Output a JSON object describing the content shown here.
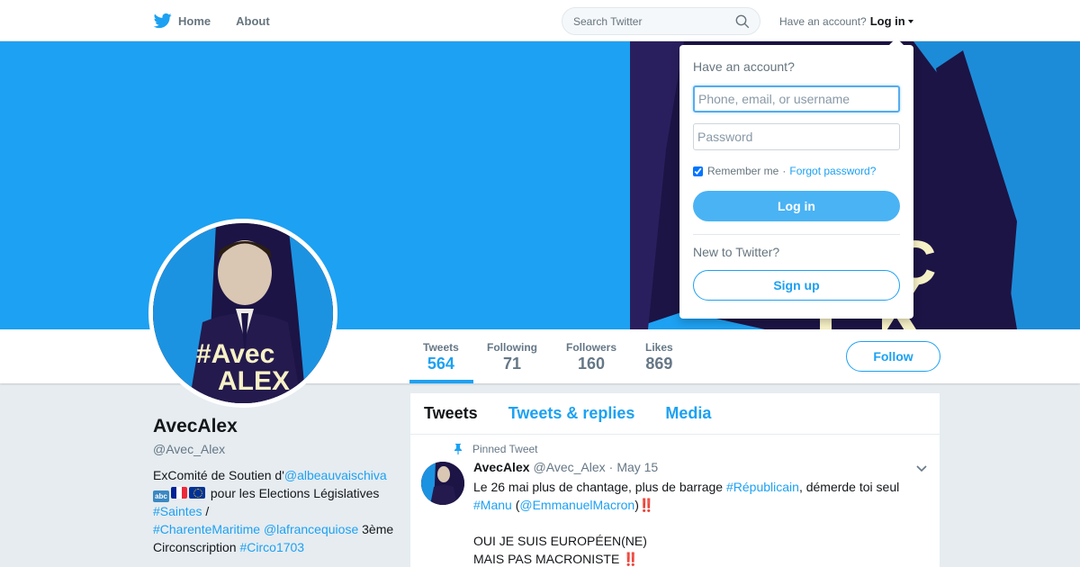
{
  "nav": {
    "home_label": "Home",
    "about_label": "About",
    "search_placeholder": "Search Twitter",
    "have_account": "Have an account?",
    "login_label": "Log in"
  },
  "profile": {
    "name": "AvecAlex",
    "handle": "@Avec_Alex",
    "avatar_text_1": "#Avec",
    "avatar_text_2": "ALEX",
    "bio": {
      "prefix": "ExComité de Soutien d'",
      "mention_1": "@albeauvaischiva",
      "emoji_abc": "abc",
      "middle": " pour les Elections Législatives ",
      "hashtag_1": "#Saintes",
      "sep": " / ",
      "hashtag_2": "#CharenteMaritime",
      "space": " ",
      "mention_2": "@lafrancequiose",
      "suffix": " 3ème Circonscription ",
      "hashtag_3": "#Circo1703"
    }
  },
  "stats": [
    {
      "label": "Tweets",
      "value": "564"
    },
    {
      "label": "Following",
      "value": "71"
    },
    {
      "label": "Followers",
      "value": "160"
    },
    {
      "label": "Likes",
      "value": "869"
    }
  ],
  "follow_label": "Follow",
  "timeline": {
    "tabs": [
      "Tweets",
      "Tweets & replies",
      "Media"
    ],
    "pinned_label": "Pinned Tweet",
    "tweet": {
      "name": "AvecAlex",
      "handle": "@Avec_Alex",
      "dot": "·",
      "date": "May 15",
      "line1_pre": "Le 26 mai plus de chantage, plus de barrage ",
      "line1_tag": "#Républicain",
      "line1_post": ", démerde toi seul",
      "line2_tag": "#Manu",
      "line2_open": " (",
      "line2_mention": "@EmmanuelMacron",
      "line2_close": ")",
      "bang": "‼️",
      "line3": "OUI JE SUIS EUROPÉEN(NE)",
      "line4": "MAIS PAS MACRONISTE "
    }
  },
  "login_dropdown": {
    "title": "Have an account?",
    "username_placeholder": "Phone, email, or username",
    "password_placeholder": "Password",
    "remember_label": "Remember me",
    "separator": "·",
    "forgot_label": "Forgot password?",
    "login_button": "Log in",
    "new_label": "New to Twitter?",
    "signup_button": "Sign up"
  },
  "banner_text": "C\nEX",
  "colors": {
    "brand": "#1da1f2",
    "banner_dark": "#1c1445",
    "banner_text": "#f7f1c6"
  }
}
